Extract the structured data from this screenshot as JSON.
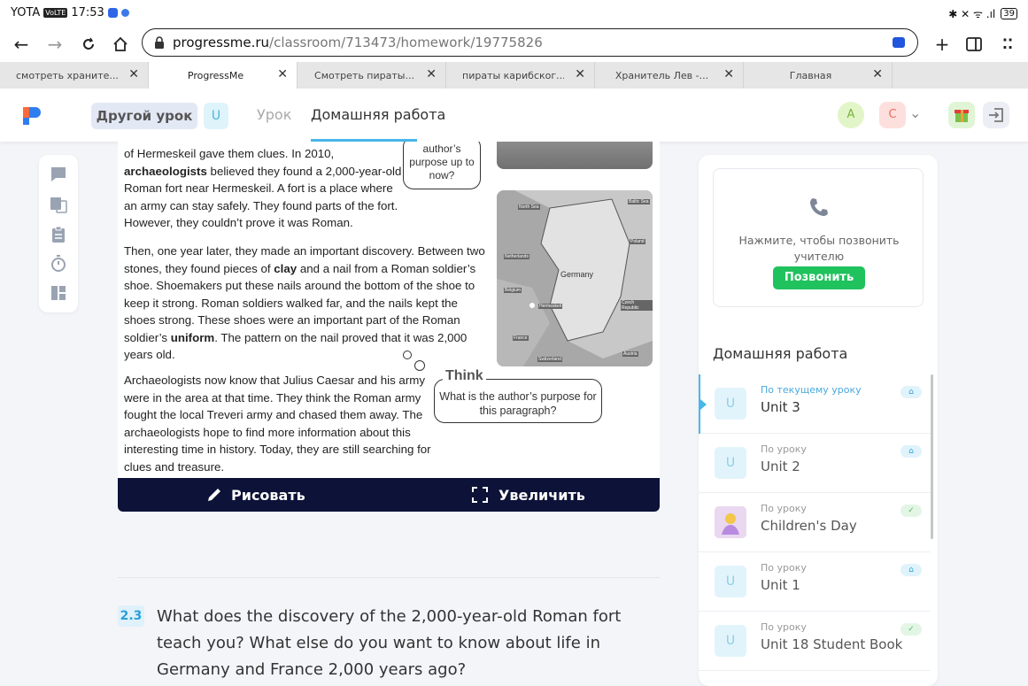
{
  "status_bar": {
    "carrier": "YOTA",
    "badge": "VoLTE",
    "time": "17:53",
    "battery": "39"
  },
  "browser": {
    "url_host": "progressme.ru",
    "url_path": "/classroom/713473/homework/19775826",
    "tabs": [
      {
        "label": "смотреть храните...",
        "active": false
      },
      {
        "label": "ProgressMe",
        "active": true
      },
      {
        "label": "Смотреть пираты...",
        "active": false
      },
      {
        "label": "пираты карибског...",
        "active": false
      },
      {
        "label": "Хранитель Лев -...",
        "active": false
      },
      {
        "label": "Главная",
        "active": false
      }
    ]
  },
  "header": {
    "other_lesson": "Другой урок",
    "lesson_badge": "U",
    "tab_lesson": "Урок",
    "tab_homework": "Домашняя работа",
    "avatar_a": "A",
    "avatar_c": "C"
  },
  "content": {
    "para1": {
      "line_a": "of Hermeskeil gave them clues. In 2010,",
      "bold_a": "archaeologists",
      "rest_a": " believed they found a 2,000-year-old Roman fort near Hermeskeil. A fort is a place where an army can stay safely. They found parts of the fort. However, they couldn’t prove it was Roman."
    },
    "para2": {
      "t1": "Then, one year later, they made an important discovery. Between two stones, they found pieces of ",
      "b1": "clay",
      "t2": " and a nail from a Roman soldier’s shoe. Shoemakers put these nails around the bottom of the shoe to keep it strong. Roman soldiers walked far, and the nails kept the shoes strong. These shoes were an important part of the Roman soldier’s ",
      "b2": "uniform",
      "t3": ". The pattern on the nail proved that it was 2,000 years old."
    },
    "para3": "Archaeologists now know that Julius Caesar and his army were in the area at that time. They think the Roman army fought the local Treveri army and chased them away. The archaeologists hope to find more information about this interesting time in history. Today, they are still searching for clues and treasure.",
    "bubble1": "author’s purpose up to now?",
    "think_word": "Think",
    "think_text": "What is the author’s purpose for this paragraph?",
    "map_labels": [
      "North Sea",
      "Baltic Sea",
      "Poland",
      "Netherlands",
      "Germany",
      "Belgium",
      "Hermeskeil",
      "Czech Republic",
      "France",
      "Switzerland",
      "Austria"
    ]
  },
  "toolbar": {
    "draw": "Рисовать",
    "zoom": "Увеличить"
  },
  "question": {
    "number": "2.3",
    "text": "What does the discovery of the 2,000-year-old Roman fort teach you? What else do you want to know about life in Germany and France 2,000 years ago?"
  },
  "right_panel": {
    "call_text": "Нажмите, чтобы позвонить учителю",
    "call_button": "Позвонить",
    "hw_title": "Домашняя работа",
    "items": [
      {
        "caption": "По текущему уроку",
        "name": "Unit 3",
        "icon": "U",
        "status": "home"
      },
      {
        "caption": "По уроку",
        "name": "Unit 2",
        "icon": "U",
        "status": "home"
      },
      {
        "caption": "По уроку",
        "name": "Children's Day",
        "icon": "image",
        "status": "done"
      },
      {
        "caption": "По уроку",
        "name": "Unit 1",
        "icon": "U",
        "status": "home"
      },
      {
        "caption": "По уроку",
        "name": "Unit 18 Student Book",
        "icon": "U",
        "status": "done"
      }
    ]
  },
  "colors": {
    "accent": "#49b7e8",
    "call_green": "#20c25e",
    "dark_bar": "#0d1238"
  }
}
